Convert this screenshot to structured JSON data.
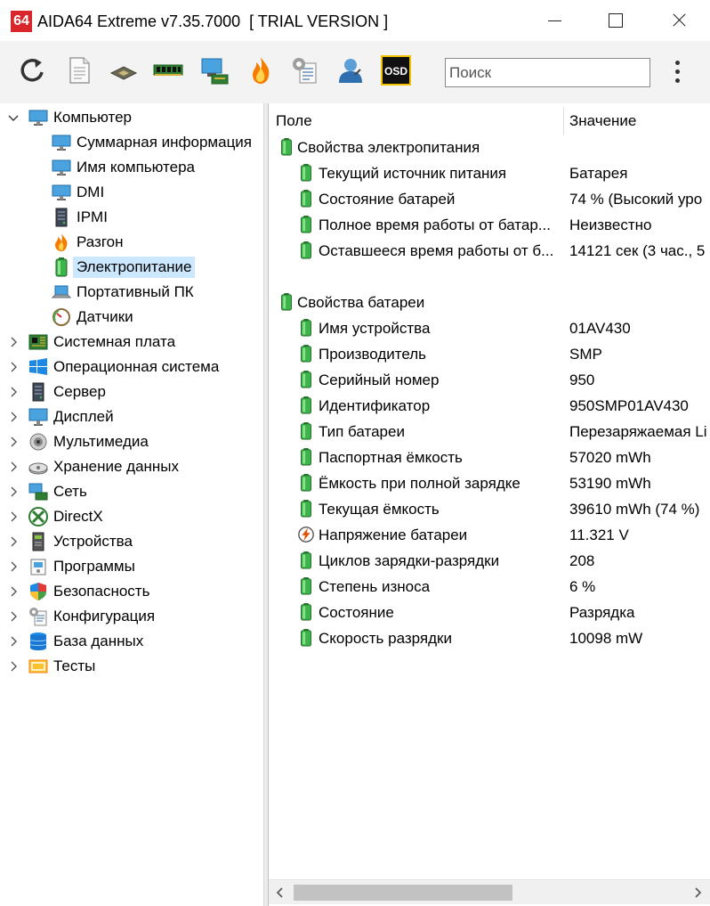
{
  "window": {
    "logo": "64",
    "title": "AIDA64 Extreme v7.35.7000  [ TRIAL VERSION ]"
  },
  "toolbar": {
    "icons": [
      "refresh-icon",
      "report-icon",
      "cpu-icon",
      "memory-icon",
      "network-icon",
      "flame-icon",
      "configuration-icon",
      "user-icon",
      "osd-icon"
    ],
    "osd_label": "OSD",
    "search_placeholder": "Поиск"
  },
  "tree": {
    "root_label": "Компьютер",
    "children": [
      {
        "label": "Суммарная информация",
        "icon": "computer-icon"
      },
      {
        "label": "Имя компьютера",
        "icon": "computer-icon"
      },
      {
        "label": "DMI",
        "icon": "computer-icon"
      },
      {
        "label": "IPMI",
        "icon": "server-icon"
      },
      {
        "label": "Разгон",
        "icon": "flame-icon"
      },
      {
        "label": "Электропитание",
        "icon": "battery-icon"
      },
      {
        "label": "Портативный ПК",
        "icon": "laptop-icon"
      },
      {
        "label": "Датчики",
        "icon": "gauge-icon"
      }
    ],
    "selected": "Электропитание",
    "groups": [
      {
        "label": "Системная плата",
        "icon": "motherboard-icon"
      },
      {
        "label": "Операционная система",
        "icon": "windows-icon"
      },
      {
        "label": "Сервер",
        "icon": "server-icon"
      },
      {
        "label": "Дисплей",
        "icon": "monitor-icon"
      },
      {
        "label": "Мультимедиа",
        "icon": "speaker-icon"
      },
      {
        "label": "Хранение данных",
        "icon": "disk-icon"
      },
      {
        "label": "Сеть",
        "icon": "network-icon"
      },
      {
        "label": "DirectX",
        "icon": "xbox-icon"
      },
      {
        "label": "Устройства",
        "icon": "device-icon"
      },
      {
        "label": "Программы",
        "icon": "programs-icon"
      },
      {
        "label": "Безопасность",
        "icon": "shield-icon"
      },
      {
        "label": "Конфигурация",
        "icon": "configuration-icon"
      },
      {
        "label": "База данных",
        "icon": "database-icon"
      },
      {
        "label": "Тесты",
        "icon": "benchmark-icon"
      }
    ]
  },
  "details": {
    "col_field": "Поле",
    "col_value": "Значение",
    "sections": [
      {
        "title": "Свойства электропитания",
        "rows": [
          {
            "field": "Текущий источник питания",
            "value": "Батарея",
            "icon": "battery-icon"
          },
          {
            "field": "Состояние батарей",
            "value": "74 % (Высокий уро",
            "icon": "battery-icon"
          },
          {
            "field": "Полное время работы от батар...",
            "value": "Неизвестно",
            "icon": "battery-icon"
          },
          {
            "field": "Оставшееся время работы от б...",
            "value": "14121 сек (3 час., 5",
            "icon": "battery-icon"
          }
        ]
      },
      {
        "title": "Свойства батареи",
        "rows": [
          {
            "field": "Имя устройства",
            "value": "01AV430",
            "icon": "battery-icon"
          },
          {
            "field": "Производитель",
            "value": "SMP",
            "icon": "battery-icon"
          },
          {
            "field": "Серийный номер",
            "value": "950",
            "icon": "battery-icon"
          },
          {
            "field": "Идентификатор",
            "value": "950SMP01AV430",
            "icon": "battery-icon"
          },
          {
            "field": "Тип батареи",
            "value": "Перезаряжаемая Li",
            "icon": "battery-icon"
          },
          {
            "field": "Паспортная ёмкость",
            "value": "57020 mWh",
            "icon": "battery-icon"
          },
          {
            "field": "Ёмкость при полной зарядке",
            "value": "53190 mWh",
            "icon": "battery-icon"
          },
          {
            "field": "Текущая ёмкость",
            "value": "39610 mWh  (74 %)",
            "icon": "battery-icon"
          },
          {
            "field": "Напряжение батареи",
            "value": "11.321 V",
            "icon": "voltage-icon"
          },
          {
            "field": "Циклов зарядки-разрядки",
            "value": "208",
            "icon": "battery-icon"
          },
          {
            "field": "Степень износа",
            "value": "6 %",
            "icon": "battery-icon"
          },
          {
            "field": "Состояние",
            "value": "Разрядка",
            "icon": "battery-icon"
          },
          {
            "field": "Скорость разрядки",
            "value": "10098 mW",
            "icon": "battery-icon"
          }
        ]
      }
    ]
  },
  "colors": {
    "selection": "#cce8ff",
    "battery_green": "#3bb54a",
    "logo_red": "#d8262b",
    "toolbar_bg": "#f3f3f3"
  }
}
